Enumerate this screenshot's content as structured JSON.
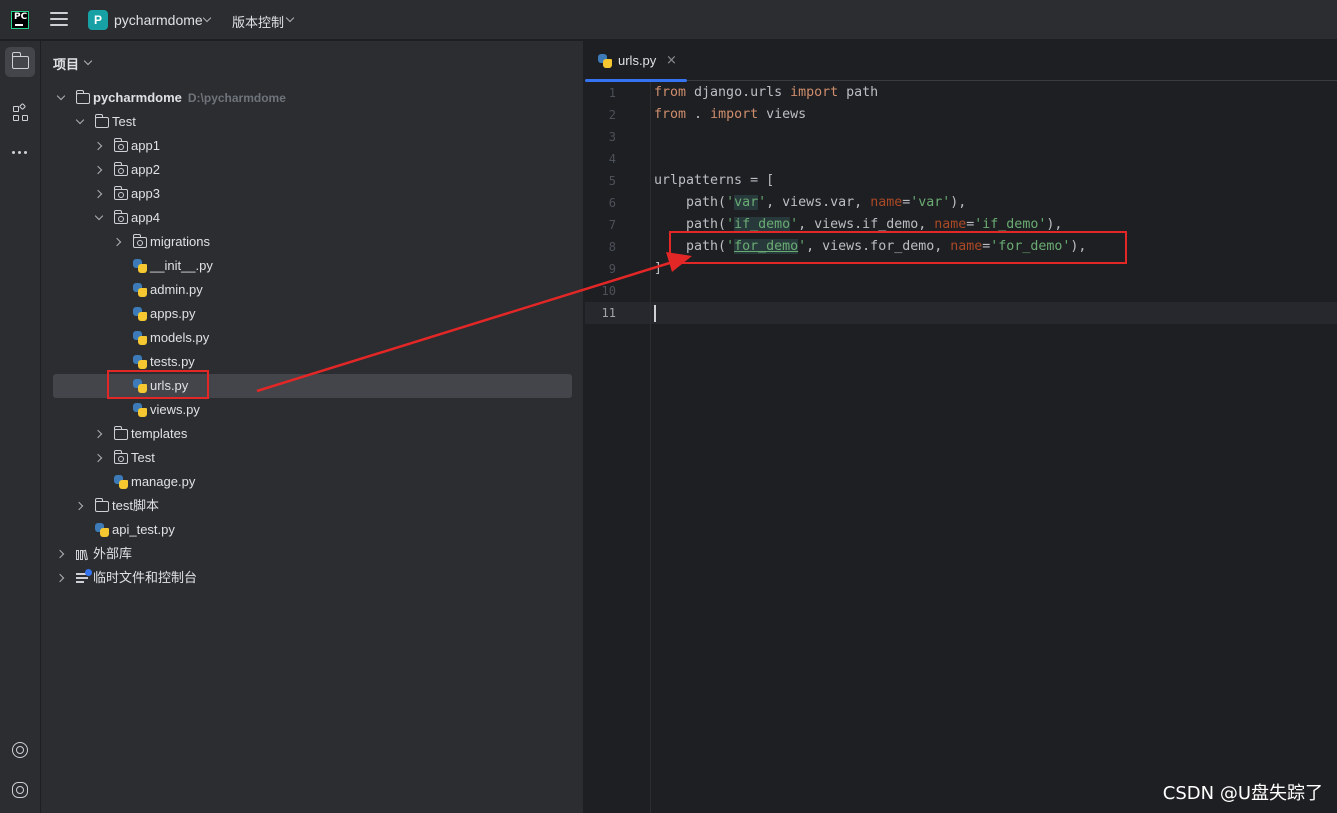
{
  "titlebar": {
    "logo_text": "PC",
    "project_badge": "P",
    "project_name": "pycharmdome",
    "vcs_label": "版本控制"
  },
  "toolstrip": {
    "icons": [
      "project-folder-icon",
      "structure-icon",
      "more-icon",
      "ai-assistant-icon",
      "python-console-icon"
    ]
  },
  "project_panel": {
    "title": "项目",
    "tree": [
      {
        "label": "pycharmdome",
        "path": "D:\\pycharmdome",
        "type": "folder",
        "expanded": true
      },
      {
        "label": "Test",
        "type": "folder",
        "expanded": true
      },
      {
        "label": "app1",
        "type": "package",
        "expanded": false
      },
      {
        "label": "app2",
        "type": "package",
        "expanded": false
      },
      {
        "label": "app3",
        "type": "package",
        "expanded": false
      },
      {
        "label": "app4",
        "type": "package",
        "expanded": true
      },
      {
        "label": "migrations",
        "type": "package",
        "expanded": false
      },
      {
        "label": "__init__.py",
        "type": "python"
      },
      {
        "label": "admin.py",
        "type": "python"
      },
      {
        "label": "apps.py",
        "type": "python"
      },
      {
        "label": "models.py",
        "type": "python"
      },
      {
        "label": "tests.py",
        "type": "python"
      },
      {
        "label": "urls.py",
        "type": "python",
        "selected": true
      },
      {
        "label": "views.py",
        "type": "python"
      },
      {
        "label": "templates",
        "type": "folder",
        "expanded": false
      },
      {
        "label": "Test",
        "type": "package",
        "expanded": false
      },
      {
        "label": "manage.py",
        "type": "python"
      },
      {
        "label": "test脚本",
        "type": "folder",
        "expanded": false
      },
      {
        "label": "api_test.py",
        "type": "python"
      },
      {
        "label": "外部库",
        "type": "library",
        "expanded": false
      },
      {
        "label": "临时文件和控制台",
        "type": "scratches",
        "expanded": false
      }
    ]
  },
  "editor": {
    "tab_label": "urls.py",
    "tab_close": "×",
    "line_numbers": [
      "1",
      "2",
      "3",
      "4",
      "5",
      "6",
      "7",
      "8",
      "9",
      "10",
      "11"
    ],
    "current_line": 11,
    "code": {
      "l1_from": "from",
      "l1_mod": " django.urls ",
      "l1_import": "import",
      "l1_name": " path",
      "l2_from": "from",
      "l2_mod": " . ",
      "l2_import": "import",
      "l2_name": " views",
      "l5": "urlpatterns = [",
      "l6_a": "    path(",
      "l6_s1a": "'",
      "l6_s1b": "var",
      "l6_s1c": "'",
      "l6_b": ", views.var, ",
      "l6_p": "name",
      "l6_eq": "=",
      "l6_s2": "'var'",
      "l6_c": "),",
      "l7_a": "    path(",
      "l7_s1a": "'",
      "l7_s1b": "if_demo",
      "l7_s1c": "'",
      "l7_b": ", views.if_demo, ",
      "l7_p": "name",
      "l7_eq": "=",
      "l7_s2": "'if_demo'",
      "l7_c": "),",
      "l8_a": "    path(",
      "l8_s1a": "'",
      "l8_s1b": "for_demo",
      "l8_s1c": "'",
      "l8_b": ", views.for_demo, ",
      "l8_p": "name",
      "l8_eq": "=",
      "l8_s2": "'for_demo'",
      "l8_c": "),",
      "l9": "]"
    }
  },
  "watermark": "CSDN @U盘失踪了",
  "colors": {
    "annotation_red": "#e32626",
    "accent_blue": "#3574f0",
    "keyword": "#cf8e6d",
    "string": "#6aab73"
  }
}
